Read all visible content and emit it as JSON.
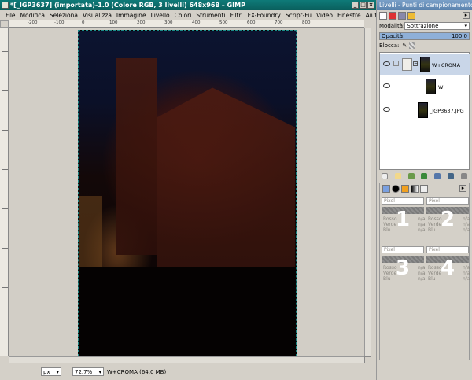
{
  "main_window": {
    "title": "*[_IGP3637] (importata)-1.0 (Colore RGB, 3 livelli) 648x968 – GIMP",
    "menu": [
      "File",
      "Modifica",
      "Seleziona",
      "Visualizza",
      "Immagine",
      "Livello",
      "Colori",
      "Strumenti",
      "Filtri",
      "FX-Foundry",
      "Script-Fu",
      "Video",
      "Finestre",
      "Aiuto"
    ],
    "ruler_labels": [
      "-200",
      "-100",
      "0",
      "100",
      "200",
      "300",
      "400",
      "500",
      "600",
      "700",
      "800"
    ],
    "status": {
      "unit": "px",
      "zoom": "72.7%",
      "info": "W+CROMA (64.0 MB)"
    }
  },
  "dock": {
    "title": "Livelli - Punti di campionamento",
    "mode_label": "Modalità:",
    "mode_value": "Sottrazione",
    "opacity_label": "Opacità:",
    "opacity_value": "100.0",
    "opacity_fraction": 1.0,
    "lock_label": "Blocca:",
    "layers": [
      {
        "name": "W+CROMA",
        "type": "group",
        "visible": true,
        "selected": true
      },
      {
        "name": "W",
        "type": "child",
        "visible": true,
        "selected": false
      },
      {
        "name": "_IGP3637.JPG",
        "type": "image",
        "visible": true,
        "selected": false
      }
    ]
  },
  "samplers": [
    {
      "number": "1",
      "mode": "Pixel",
      "labels": [
        "Rosso",
        "Verde",
        "Blu"
      ],
      "value": "n/a"
    },
    {
      "number": "2",
      "mode": "Pixel",
      "labels": [
        "Rosso",
        "Verde",
        "Blu"
      ],
      "value": "n/a"
    },
    {
      "number": "3",
      "mode": "Pixel",
      "labels": [
        "Rosso",
        "Verde",
        "Blu"
      ],
      "value": "n/a"
    },
    {
      "number": "4",
      "mode": "Pixel",
      "labels": [
        "Rosso",
        "Verde",
        "Blu"
      ],
      "value": "n/a"
    }
  ]
}
